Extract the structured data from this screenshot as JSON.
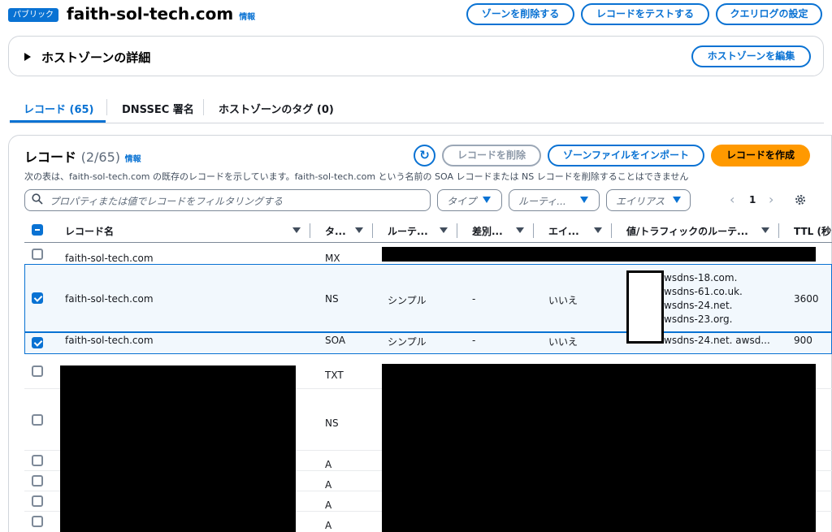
{
  "header": {
    "badge": "パブリック",
    "domain": "faith-sol-tech.com",
    "info": "情報",
    "buttons": {
      "delete_zone": "ゾーンを削除する",
      "test_record": "レコードをテストする",
      "query_log": "クエリログの設定"
    }
  },
  "details": {
    "title": "ホストゾーンの詳細",
    "edit_button": "ホストゾーンを編集"
  },
  "tabs": [
    {
      "label": "レコード (65)",
      "active": true
    },
    {
      "label": "DNSSEC 署名",
      "active": false
    },
    {
      "label": "ホストゾーンのタグ (0)",
      "active": false
    }
  ],
  "records": {
    "title": "レコード",
    "count": "(2/65)",
    "info": "情報",
    "description": "次の表は、faith-sol-tech.com の既存のレコードを示しています。faith-sol-tech.com という名前の SOA レコードまたは NS レコードを削除することはできません",
    "buttons": {
      "delete": "レコードを削除",
      "import": "ゾーンファイルをインポート",
      "create": "レコードを作成"
    },
    "search_placeholder": "プロパティまたは値でレコードをフィルタリングする",
    "filters": {
      "type": "タイプ",
      "routing": "ルーティ...",
      "alias": "エイリアス"
    },
    "page": "1",
    "columns": [
      "レコード名",
      "タ...",
      "ルーテ...",
      "差別...",
      "エイ...",
      "値/トラフィックのルーテ...",
      "TTL (秒"
    ],
    "rows": [
      {
        "name": "faith-sol-tech.com",
        "type": "MX",
        "routing": "",
        "diff": "",
        "alias": "",
        "values": [],
        "ttl": "",
        "checked": false
      },
      {
        "name": "faith-sol-tech.com",
        "type": "NS",
        "routing": "シンプル",
        "diff": "-",
        "alias": "いいえ",
        "values": [
          "wsdns-18.com.",
          "wsdns-61.co.uk.",
          "wsdns-24.net.",
          "wsdns-23.org."
        ],
        "ttl": "3600",
        "checked": true
      },
      {
        "name": "faith-sol-tech.com",
        "type": "SOA",
        "routing": "シンプル",
        "diff": "-",
        "alias": "いいえ",
        "values": [
          "wsdns-24.net. awsd..."
        ],
        "ttl": "900",
        "checked": true
      },
      {
        "name": "",
        "type": "TXT",
        "checked": false
      },
      {
        "name": "",
        "type": "NS",
        "checked": false
      },
      {
        "name": "",
        "type": "A",
        "checked": false
      },
      {
        "name": "",
        "type": "A",
        "checked": false
      },
      {
        "name": "",
        "type": "A",
        "checked": false
      },
      {
        "name": "",
        "type": "A",
        "checked": false
      }
    ]
  }
}
